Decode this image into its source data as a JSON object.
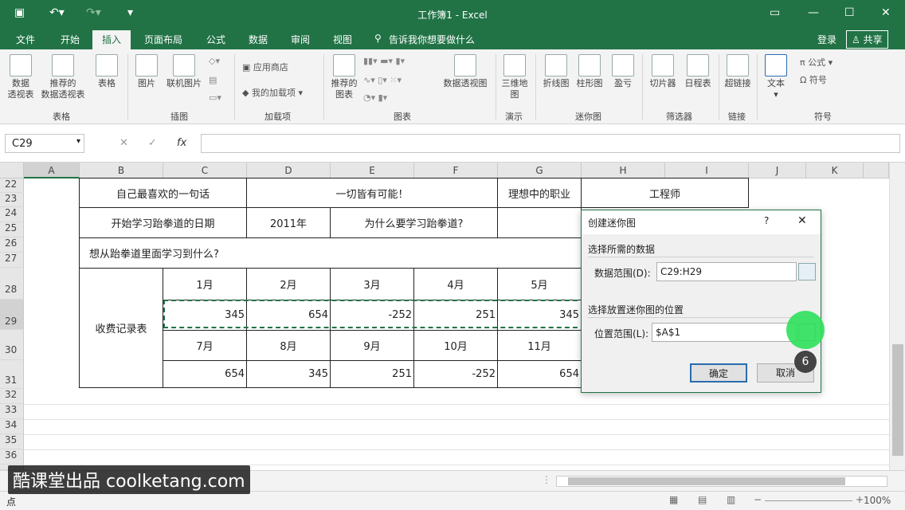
{
  "window": {
    "title": "工作簿1 - Excel"
  },
  "menu": [
    "文件",
    "开始",
    "插入",
    "页面布局",
    "公式",
    "数据",
    "审阅",
    "视图"
  ],
  "tell_me": "告诉我你想要做什么",
  "account": {
    "login": "登录",
    "share": "共享"
  },
  "ribbon": {
    "btn_pivot": "数据\n透视表",
    "btn_rec_pivot": "推荐的\n数据透视表",
    "btn_table": "表格",
    "btn_picture": "图片",
    "btn_online_pic": "联机图片",
    "btn_store": "应用商店",
    "btn_my_addins": "我的加载项",
    "btn_rec_charts": "推荐的\n图表",
    "btn_pivot_chart": "数据透视图",
    "btn_3d": "三维地\n图",
    "btn_line": "折线图",
    "btn_column": "柱形图",
    "btn_winloss": "盈亏",
    "btn_slicer": "切片器",
    "btn_timeline": "日程表",
    "btn_link": "超链接",
    "btn_text": "文本",
    "btn_formula": "公式",
    "btn_symbol": "符号",
    "groups": {
      "tables": "表格",
      "illustrations": "插图",
      "addins": "加载项",
      "charts": "图表",
      "tours": "演示",
      "sparklines": "迷你图",
      "filters": "筛选器",
      "links": "链接",
      "symbols": "符号"
    }
  },
  "formula_bar": {
    "name_box": "C29",
    "fx": "fx"
  },
  "columns": [
    "A",
    "B",
    "C",
    "D",
    "E",
    "F",
    "G",
    "H",
    "I",
    "J",
    "K"
  ],
  "rows": [
    "22",
    "23",
    "24",
    "25",
    "26",
    "27",
    "28",
    "29",
    "30",
    "31",
    "32",
    "33",
    "34",
    "35",
    "36",
    "37"
  ],
  "sheet": {
    "b22": "自己最喜欢的一句话",
    "d22": "一切皆有可能！",
    "g22": "理想中的职业",
    "h22": "工程师",
    "b24": "开始学习跆拳道的日期",
    "d24": "2011年",
    "e24": "为什么要学习跆拳道?",
    "b26": "想从跆拳道里面学习到什么?",
    "b28": "收费记录表",
    "months1": [
      "1月",
      "2月",
      "3月",
      "4月",
      "5月"
    ],
    "values1": [
      "345",
      "654",
      "-252",
      "251",
      "345"
    ],
    "months2": [
      "7月",
      "8月",
      "9月",
      "10月",
      "11月"
    ],
    "values2": [
      "654",
      "345",
      "251",
      "-252",
      "654"
    ]
  },
  "dialog": {
    "title": "创建迷你图",
    "help": "?",
    "close": "✕",
    "section1": "选择所需的数据",
    "data_range_label": "数据范围(D):",
    "data_range_value": "C29:H29",
    "section2": "选择放置迷你图的位置",
    "location_label": "位置范围(L):",
    "location_value": "$A$1",
    "ok": "确定",
    "cancel": "取消"
  },
  "step_badge": "6",
  "status": {
    "mode": "点",
    "zoom": "100%"
  },
  "watermark": "酷课堂出品 coolketang.com"
}
